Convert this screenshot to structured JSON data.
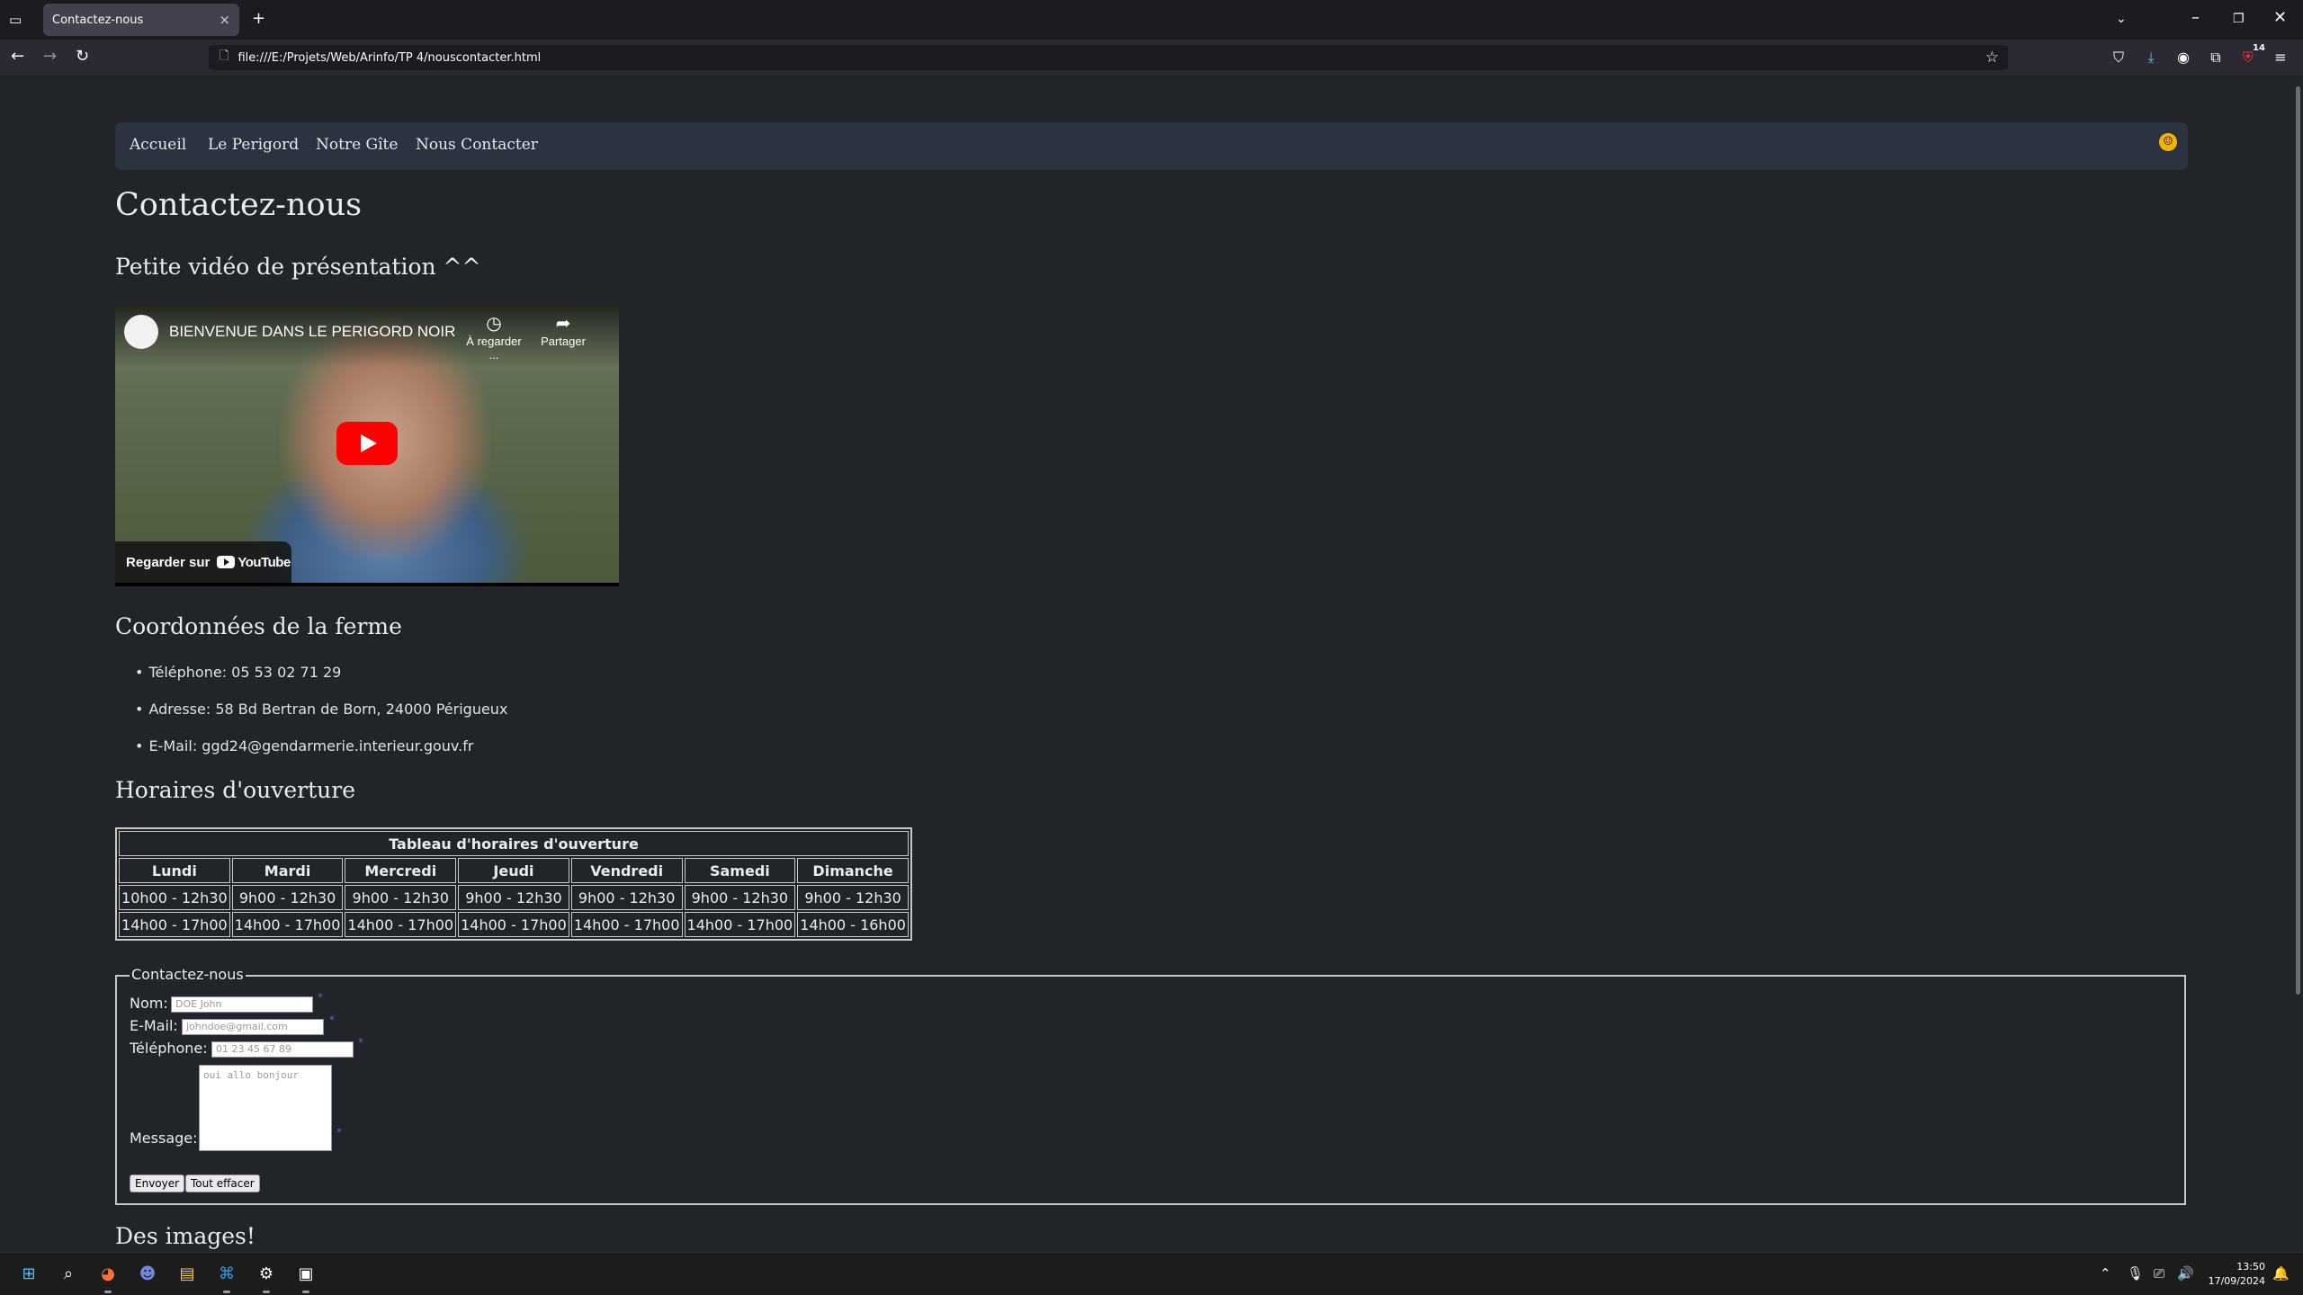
{
  "browser": {
    "tab_title": "Contactez-nous",
    "tab_close": "×",
    "new_tab": "+",
    "url": "file:///E:/Projets/Web/Arinfo/TP 4/nouscontacter.html",
    "extension_badge": "14"
  },
  "nav": {
    "items": [
      "Accueil",
      "Le Perigord",
      "Notre Gîte",
      "Nous Contacter"
    ],
    "emoji": "☺"
  },
  "page": {
    "title": "Contactez-nous",
    "video_heading": "Petite vidéo de présentation ^^",
    "coords_heading": "Coordonnées de la ferme",
    "hours_heading": "Horaires d'ouverture",
    "images_heading": "Des images!"
  },
  "video": {
    "title": "BIENVENUE DANS LE PERIGORD NOIR",
    "watch_later": "À regarder ...",
    "share": "Partager",
    "watch_on": "Regarder sur",
    "youtube": "YouTube"
  },
  "contact_info": [
    "Téléphone: 05 53 02 71 29",
    "Adresse: 58 Bd Bertran de Born, 24000 Périgueux",
    "E-Mail: ggd24@gendarmerie.interieur.gouv.fr"
  ],
  "hours_table": {
    "caption": "Tableau d'horaires d'ouverture",
    "days": [
      "Lundi",
      "Mardi",
      "Mercredi",
      "Jeudi",
      "Vendredi",
      "Samedi",
      "Dimanche"
    ],
    "morning": [
      "10h00 - 12h30",
      "9h00 - 12h30",
      "9h00 - 12h30",
      "9h00 - 12h30",
      "9h00 - 12h30",
      "9h00 - 12h30",
      "9h00 - 12h30"
    ],
    "afternoon": [
      "14h00 - 17h00",
      "14h00 - 17h00",
      "14h00 - 17h00",
      "14h00 - 17h00",
      "14h00 - 17h00",
      "14h00 - 17h00",
      "14h00 - 16h00"
    ]
  },
  "form": {
    "legend": "Contactez-nous",
    "name_label": "Nom:",
    "name_placeholder": "DOE John",
    "email_label": "E-Mail:",
    "email_placeholder": "johndoe@gmail.com",
    "phone_label": "Téléphone:",
    "phone_placeholder": "01 23 45 67 89",
    "message_label": "Message:",
    "message_placeholder": "oui allo bonjour",
    "required_mark": "*",
    "submit": "Envoyer",
    "reset": "Tout effacer"
  },
  "taskbar": {
    "time": "13:50",
    "date": "17/09/2024"
  }
}
